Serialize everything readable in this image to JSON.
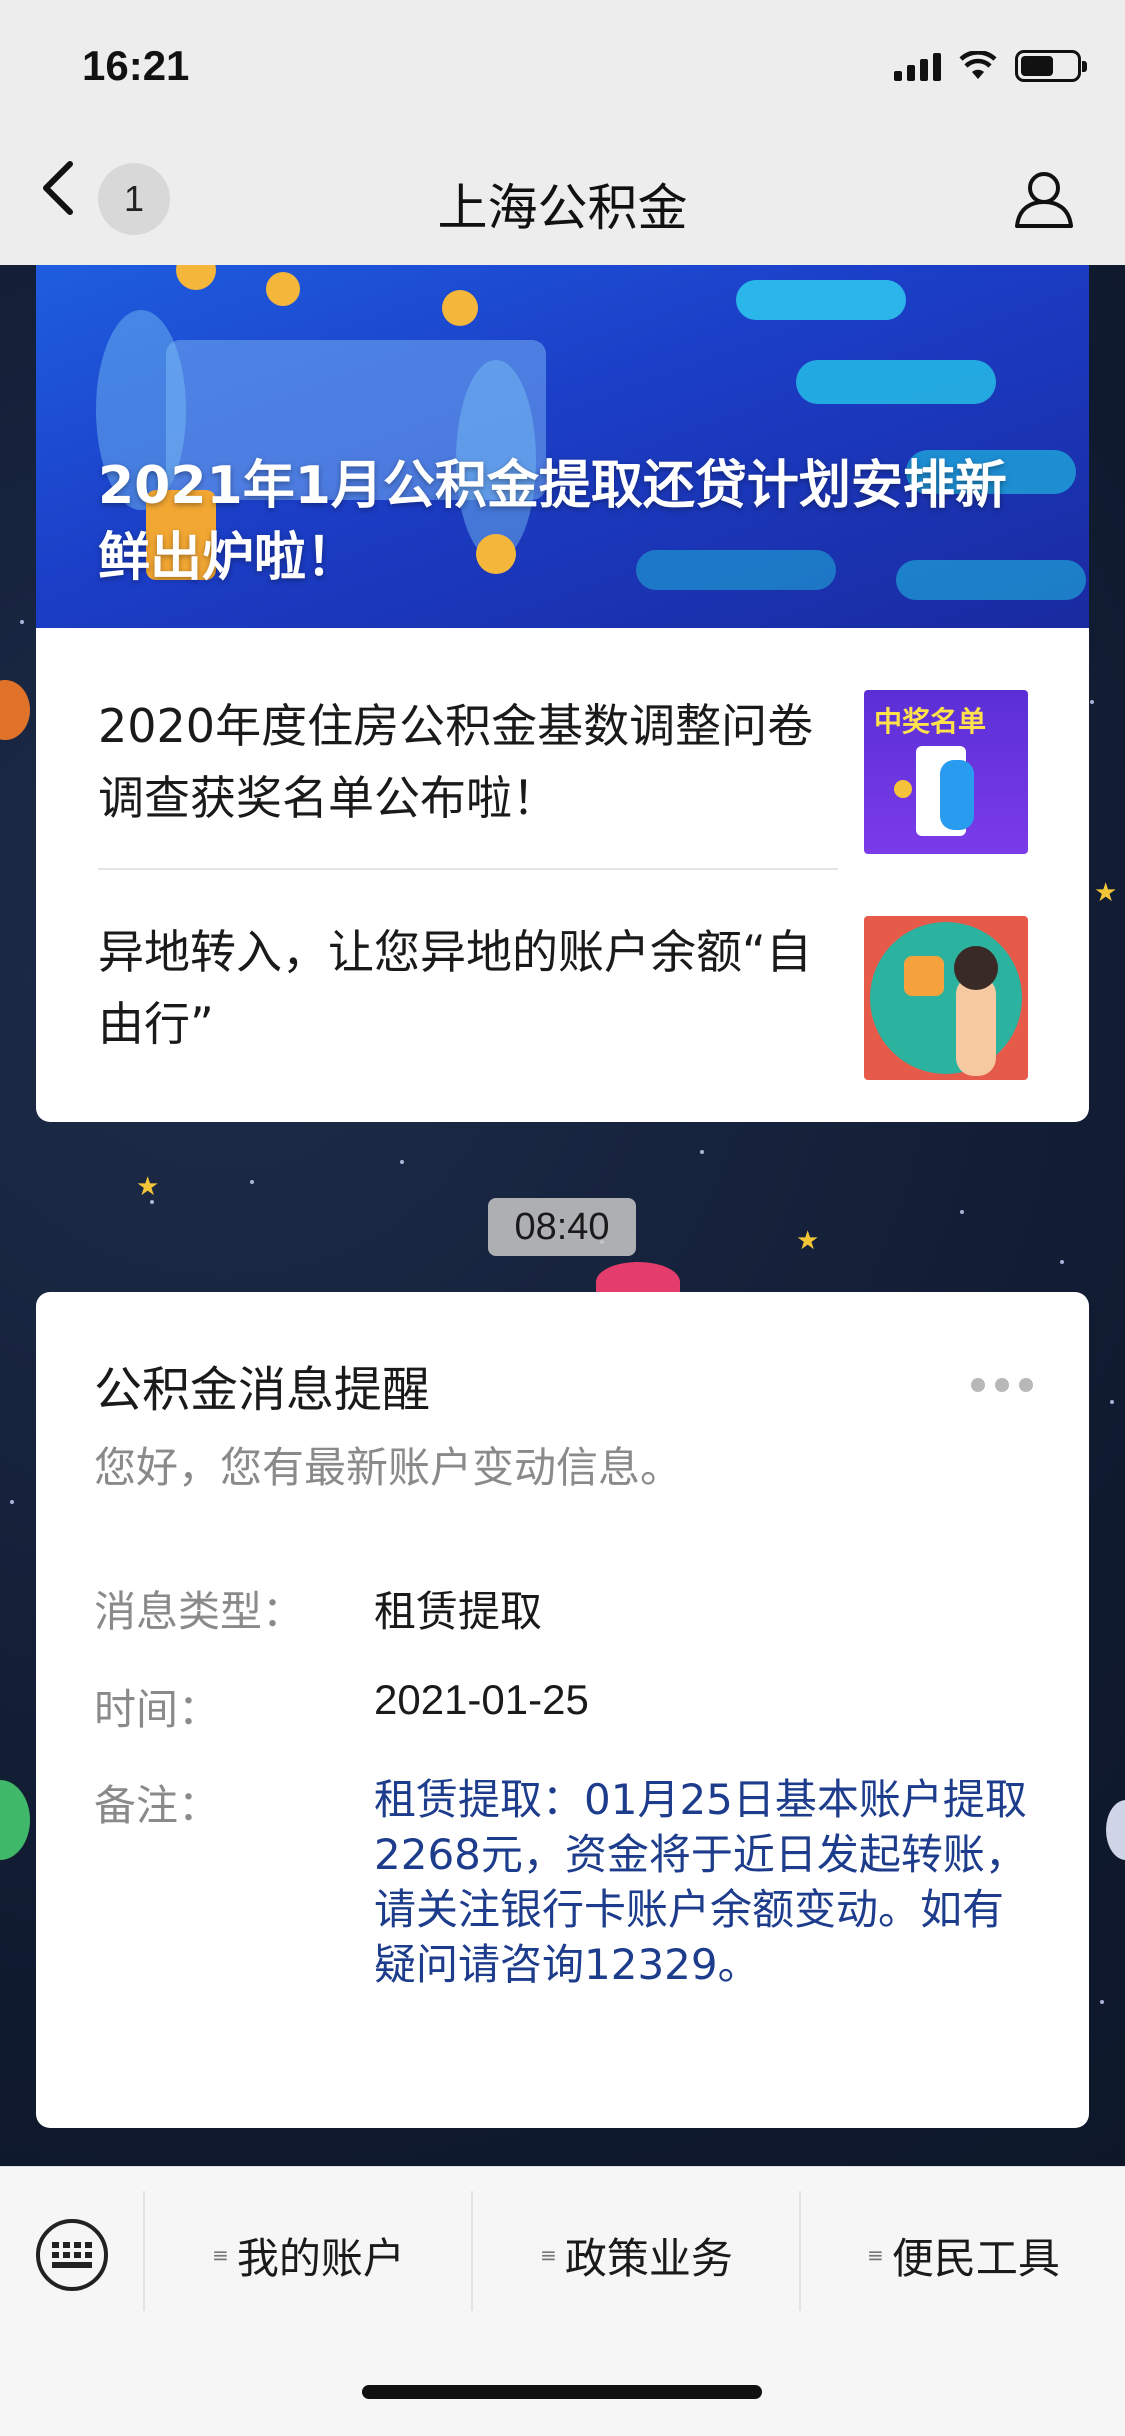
{
  "status_bar": {
    "time": "16:21"
  },
  "nav": {
    "back_badge": "1",
    "title": "上海公积金"
  },
  "article": {
    "hero_title": "2021年1月公积金提取还贷计划安排新鲜出炉啦！",
    "items": [
      {
        "title": "2020年度住房公积金基数调整问卷调查获奖名单公布啦！",
        "thumb_text": "中奖名单"
      },
      {
        "title": "异地转入，让您异地的账户余额“自由行”"
      }
    ]
  },
  "timestamp": "08:40",
  "message": {
    "title": "公积金消息提醒",
    "subtitle": "您好，您有最新账户变动信息。",
    "fields": [
      {
        "label": "消息类型：",
        "value": "租赁提取"
      },
      {
        "label": "时间：",
        "value": "2021-01-25"
      },
      {
        "label": "备注：",
        "value": "租赁提取：01月25日基本账户提取2268元，资金将于近日发起转账，请关注银行卡账户余额变动。如有疑问请咨询12329。"
      }
    ]
  },
  "menu": {
    "items": [
      "我的账户",
      "政策业务",
      "便民工具"
    ]
  },
  "colors": {
    "note_blue": "#1d3c8c",
    "background": "#132038"
  }
}
